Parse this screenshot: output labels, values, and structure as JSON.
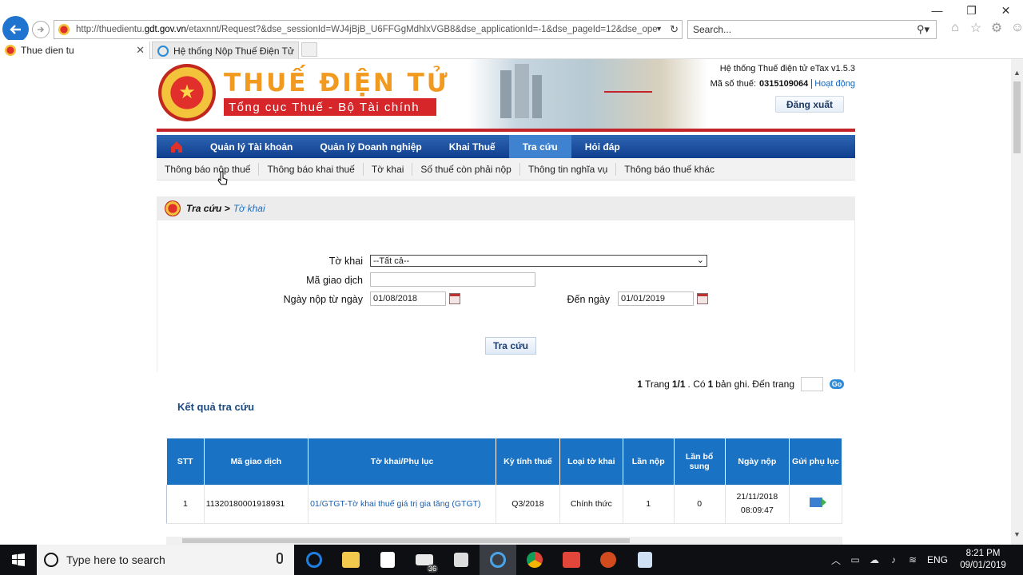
{
  "browser": {
    "url_prefix": "http://thuedientu.",
    "url_domain": "gdt.gov.vn",
    "url_rest": "/etaxnnt/Request?&dse_sessionId=WJ4jBjB_U6FFGgMdhlxVGB8&dse_applicationId=-1&dse_pageId=12&dse_operatio",
    "search_placeholder": "Search...",
    "tabs": [
      {
        "label": "Thue dien tu",
        "active": true
      },
      {
        "label": "Hệ thống Nộp Thuế Điện Tử",
        "active": false
      }
    ],
    "tab_close": "✕"
  },
  "site": {
    "brand_title": "THUẾ ĐIỆN TỬ",
    "brand_subtitle": "Tổng cục Thuế - Bộ Tài chính",
    "system_name": "Hệ thống Thuế điện tử eTax v1.5.3",
    "tax_code_label": "Mã số thuế:",
    "tax_code": "0315109064",
    "status": "Hoạt động",
    "logout": "Đăng xuất",
    "main_nav": [
      {
        "label": "Quản lý Tài khoản",
        "active": false
      },
      {
        "label": "Quản lý Doanh nghiệp",
        "active": false
      },
      {
        "label": "Khai Thuế",
        "active": false
      },
      {
        "label": "Tra cứu",
        "active": true
      },
      {
        "label": "Hỏi đáp",
        "active": false
      }
    ],
    "sub_nav": [
      "Thông báo nộp thuế",
      "Thông báo khai thuế",
      "Tờ khai",
      "Số thuế còn phải nộp",
      "Thông tin nghĩa vụ",
      "Thông báo thuế khác"
    ],
    "breadcrumb": {
      "parent": "Tra cứu >",
      "current": "Tờ khai"
    }
  },
  "form": {
    "to_khai_label": "Tờ khai",
    "to_khai_value": "--Tất cả--",
    "ma_gd_label": "Mã giao dịch",
    "ma_gd_value": "",
    "tu_ngay_label": "Ngày nộp từ ngày",
    "tu_ngay_value": "01/08/2018",
    "den_ngay_label": "Đến ngày",
    "den_ngay_value": "01/01/2019",
    "submit": "Tra cứu"
  },
  "pager": {
    "current": "1",
    "trang_label": "Trang",
    "page_of": "1/1",
    "co_label": ". Có",
    "records": "1",
    "records_suffix": "bản ghi. Đến trang",
    "go": "Go"
  },
  "results": {
    "title": "Kết quả tra cứu",
    "headers": [
      "STT",
      "Mã giao dịch",
      "Tờ khai/Phụ lục",
      "Kỳ tính thuế",
      "Loại tờ khai",
      "Lần nộp",
      "Lần bổ sung",
      "Ngày nộp",
      "Gửi phụ lục"
    ],
    "rows": [
      {
        "stt": "1",
        "ma_gd": "11320180001918931",
        "to_khai": "01/GTGT-Tờ khai thuế giá trị gia tăng (GTGT)",
        "ky": "Q3/2018",
        "loai": "Chính thức",
        "lan_nop": "1",
        "lan_bs": "0",
        "ngay_date": "21/11/2018",
        "ngay_time": "08:09:47"
      }
    ]
  },
  "taskbar": {
    "search_placeholder": "Type here to search",
    "mail_badge": "36",
    "lang": "ENG",
    "time": "8:21 PM",
    "date": "09/01/2019"
  },
  "colors": {
    "nav_blue": "#0f3f8e",
    "nav_active": "#3f82cf",
    "brand_orange": "#f29a1f",
    "brand_red": "#d6262a",
    "table_header": "#1a72c5"
  }
}
